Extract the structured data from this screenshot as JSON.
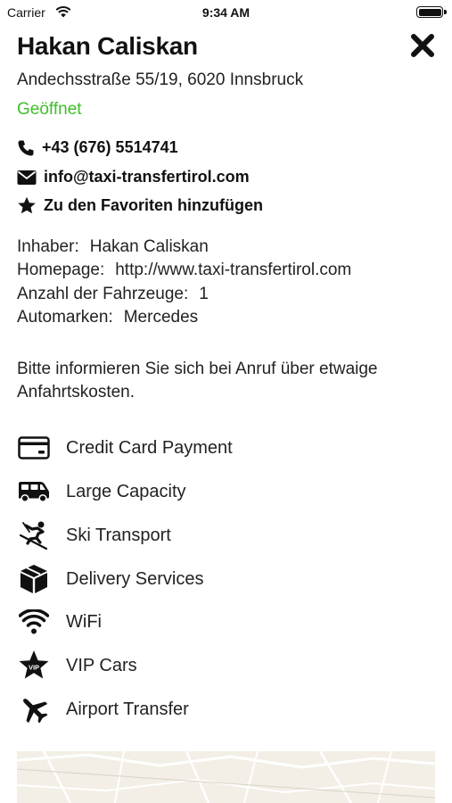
{
  "status_bar": {
    "carrier": "Carrier",
    "time": "9:34 AM"
  },
  "company": {
    "name": "Hakan Caliskan",
    "address": "Andechsstraße 55/19, 6020 Innsbruck",
    "status": "Geöffnet",
    "status_color": "#3fbf2a"
  },
  "contact": {
    "phone": "+43 (676) 5514741",
    "email": "info@taxi-transfertirol.com",
    "favorite": "Zu den Favoriten hinzufügen"
  },
  "details": [
    {
      "label": "Inhaber:",
      "value": "Hakan Caliskan"
    },
    {
      "label": "Homepage:",
      "value": "http://www.taxi-transfertirol.com"
    },
    {
      "label": "Anzahl der Fahrzeuge:",
      "value": "1"
    },
    {
      "label": "Automarken:",
      "value": "Mercedes"
    }
  ],
  "notice": "Bitte informieren Sie sich bei Anruf über etwaige Anfahrtskosten.",
  "features": [
    {
      "icon": "credit-card-icon",
      "label": "Credit Card Payment"
    },
    {
      "icon": "bus-icon",
      "label": "Large Capacity"
    },
    {
      "icon": "skier-icon",
      "label": "Ski Transport"
    },
    {
      "icon": "package-icon",
      "label": "Delivery Services"
    },
    {
      "icon": "wifi-icon",
      "label": "WiFi"
    },
    {
      "icon": "vip-star-icon",
      "label": "VIP Cars"
    },
    {
      "icon": "airplane-icon",
      "label": "Airport Transfer"
    }
  ],
  "vip_badge_text": "VIP"
}
